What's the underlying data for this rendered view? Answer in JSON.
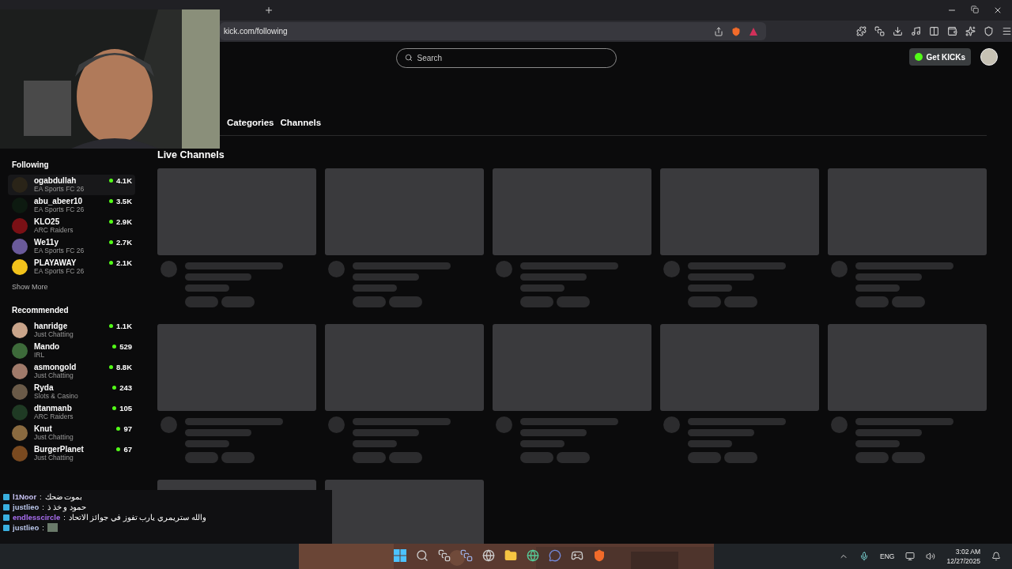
{
  "browser": {
    "url": "kick.com/following"
  },
  "header": {
    "search": {
      "placeholder": "Search"
    },
    "get_kicks": "Get KICKs"
  },
  "sidebar": {
    "following_title": "Following",
    "following": [
      {
        "name": "ogabdullah",
        "category": "EA Sports FC 26",
        "viewers": "4.1K",
        "color": "#2a2418"
      },
      {
        "name": "abu_abeer10",
        "category": "EA Sports FC 26",
        "viewers": "3.5K",
        "color": "#0d1a10"
      },
      {
        "name": "KLO25",
        "category": "ARC Raiders",
        "viewers": "2.9K",
        "color": "#7a1015"
      },
      {
        "name": "We11y",
        "category": "EA Sports FC 26",
        "viewers": "2.7K",
        "color": "#6a5a9a"
      },
      {
        "name": "PLAYAWAY",
        "category": "EA Sports FC 26",
        "viewers": "2.1K",
        "color": "#f2c21b"
      }
    ],
    "show_more": "Show More",
    "recommended_title": "Recommended",
    "recommended": [
      {
        "name": "hanridge",
        "category": "Just Chatting",
        "viewers": "1.1K",
        "color": "#c9a48a"
      },
      {
        "name": "Mando",
        "category": "IRL",
        "viewers": "529",
        "color": "#3d6a3a"
      },
      {
        "name": "asmongold",
        "category": "Just Chatting",
        "viewers": "8.8K",
        "color": "#a07a6a"
      },
      {
        "name": "Ryda",
        "category": "Slots & Casino",
        "viewers": "243",
        "color": "#6a5a48"
      },
      {
        "name": "dtanmanb",
        "category": "ARC Raiders",
        "viewers": "105",
        "color": "#1f3a24"
      },
      {
        "name": "Knut",
        "category": "Just Chatting",
        "viewers": "97",
        "color": "#8a6a40"
      },
      {
        "name": "BurgerPlanet",
        "category": "Just Chatting",
        "viewers": "67",
        "color": "#7a4a20"
      }
    ]
  },
  "nav_tabs": [
    {
      "label": "Categories"
    },
    {
      "label": "Channels"
    }
  ],
  "section_title": "Live Channels",
  "cards": [
    {
      "kind": "loading"
    },
    {
      "kind": "loading"
    },
    {
      "kind": "loading"
    },
    {
      "kind": "loading"
    },
    {
      "kind": "loading"
    },
    {
      "kind": "loading"
    },
    {
      "kind": "loading"
    },
    {
      "kind": "loading"
    },
    {
      "kind": "loading"
    },
    {
      "kind": "loading"
    },
    {
      "kind": "cut"
    },
    {
      "kind": "cut"
    }
  ],
  "chat": [
    {
      "kind": "text",
      "name": "l1Noor",
      "separator": ":",
      "color": "#c9c3f5",
      "message": "بموت ضحك"
    },
    {
      "kind": "text",
      "name": "justlieo",
      "separator": ":",
      "color": "#b8c4e8",
      "message": "حمود و خذ ذ"
    },
    {
      "kind": "text",
      "name": "endlesscircle",
      "separator": ":",
      "color": "#a86ef0",
      "message": "والله ستريمري يارب تفوز في جوائز الاتحاد"
    },
    {
      "kind": "emote",
      "name": "justlieo",
      "separator": ":",
      "color": "#b8c4e8"
    }
  ],
  "taskbar": {
    "language": "ENG",
    "time": "3:02 AM",
    "date": "12/27/2025"
  }
}
